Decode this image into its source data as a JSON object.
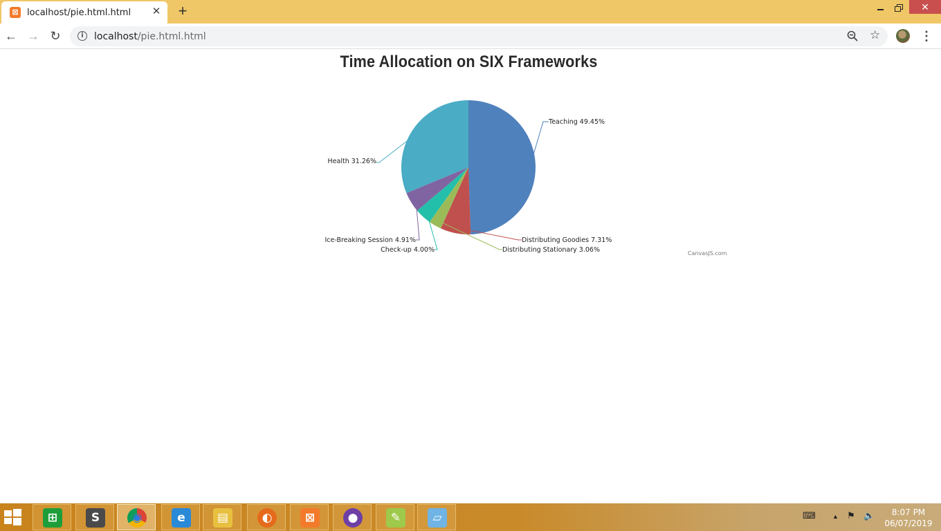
{
  "browser": {
    "tab_title": "localhost/pie.html.html",
    "url_host": "localhost",
    "url_path": "/pie.html.html"
  },
  "chart_data": {
    "type": "pie",
    "title": "Time Allocation on SIX Frameworks",
    "slices": [
      {
        "label": "Teaching",
        "value": 49.45,
        "color": "#4f81bc"
      },
      {
        "label": "Distributing Goodies",
        "value": 7.31,
        "color": "#c0504e"
      },
      {
        "label": "Distributing Stationary",
        "value": 3.06,
        "color": "#9bbb58"
      },
      {
        "label": "Check-up",
        "value": 4.0,
        "color": "#23bfaa"
      },
      {
        "label": "Ice-Breaking Session",
        "value": 4.91,
        "color": "#8064a1"
      },
      {
        "label": "Health",
        "value": 31.26,
        "color": "#4aacc5"
      }
    ],
    "value_suffix": "%",
    "credit": "CanvasJS.com"
  },
  "taskbar": {
    "apps": [
      {
        "name": "store",
        "icon": "store-icon",
        "color": "#1e9e3a"
      },
      {
        "name": "sublime",
        "icon": "sublime-text-icon",
        "color": "#4a4a4a"
      },
      {
        "name": "chrome",
        "icon": "chrome-icon",
        "color": "#ffffff"
      },
      {
        "name": "ie",
        "icon": "internet-explorer-icon",
        "color": "#2a8ad8"
      },
      {
        "name": "explorer",
        "icon": "file-explorer-icon",
        "color": "#e8c040"
      },
      {
        "name": "firefox",
        "icon": "firefox-icon",
        "color": "#e66a1c"
      },
      {
        "name": "xampp",
        "icon": "xampp-icon",
        "color": "#f37a2a"
      },
      {
        "name": "github",
        "icon": "github-desktop-icon",
        "color": "#6e3fa5"
      },
      {
        "name": "notepadpp",
        "icon": "notepad-plus-plus-icon",
        "color": "#9ec94a"
      },
      {
        "name": "notepad",
        "icon": "notepad-icon",
        "color": "#6fb4e4"
      }
    ],
    "clock_time": "8:07 PM",
    "clock_date": "06/07/2019"
  }
}
